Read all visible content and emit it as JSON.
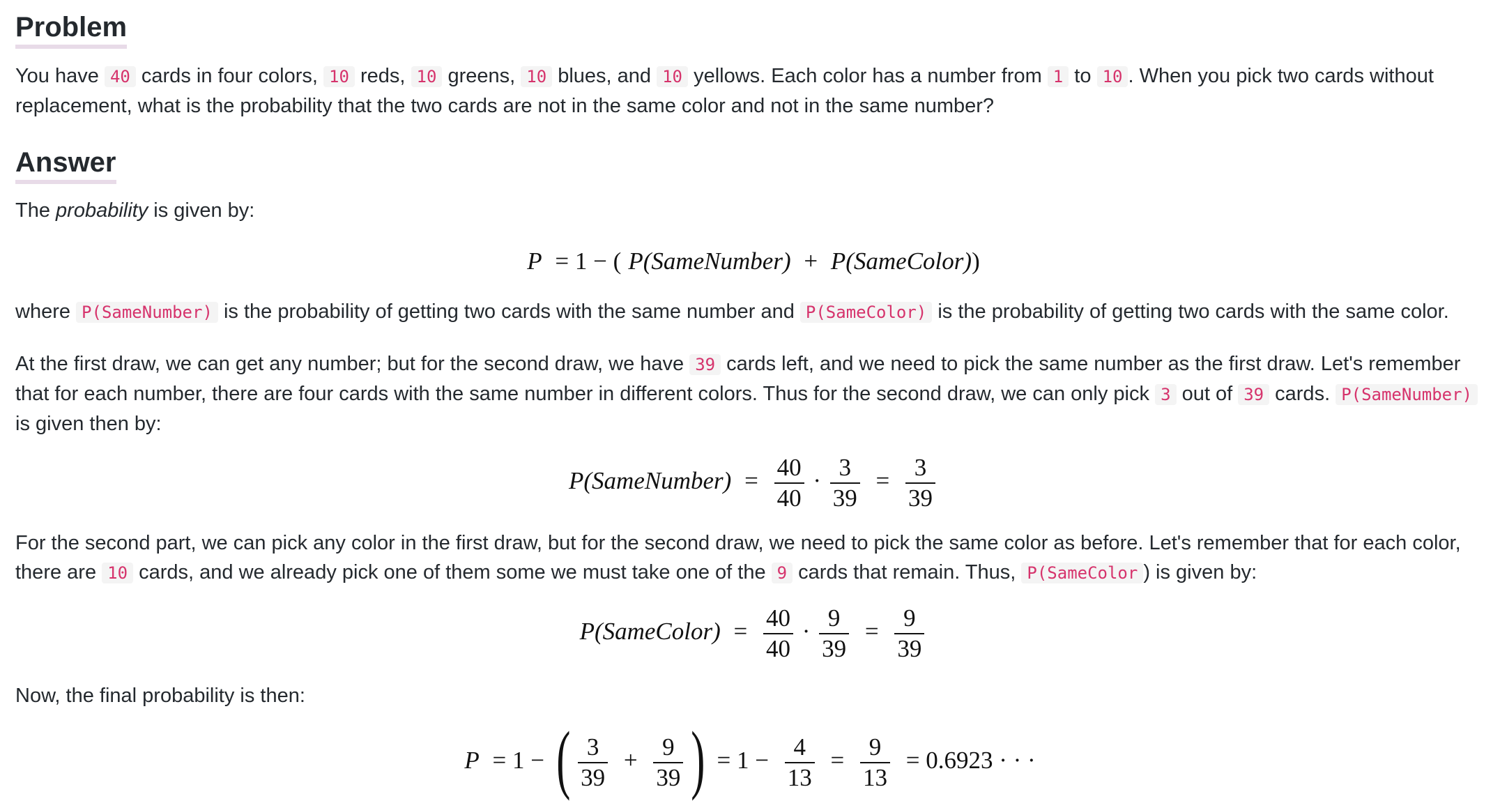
{
  "problem": {
    "heading": "Problem",
    "text1": "You have ",
    "code1": "40",
    "text2": " cards in four colors, ",
    "code2": "10",
    "text3": " reds, ",
    "code3": "10",
    "text4": " greens, ",
    "code4": "10",
    "text5": " blues, and ",
    "code5": "10",
    "text6": " yellows. Each color has a number from ",
    "code6": "1",
    "text7": " to ",
    "code7": "10",
    "text8": ". When you pick two cards without replacement, what is the probability that the two cards are not in the same color and not in the same number?"
  },
  "answer": {
    "heading": "Answer",
    "intro_pre": "The ",
    "intro_em": "probability",
    "intro_post": " is given by:",
    "eq1": {
      "lhs": "P",
      "rhs_a": "= 1 − (",
      "p1": "P",
      "arg1": "(SameNumber)",
      "plus": " + ",
      "p2": "P",
      "arg2": "(SameColor)",
      "close": ")"
    },
    "where": {
      "t1": "where ",
      "c1": "P(SameNumber)",
      "t2": " is the probability of getting two cards with the same number and ",
      "c2": "P(SameColor)",
      "t3": " is the probability of getting two cards with the same color."
    },
    "first_draw": {
      "t1": "At the first draw, we can get any number; but for the second draw, we have ",
      "c1": "39",
      "t2": " cards left, and we need to pick the same number as the first draw. Let's remember that for each number, there are four cards with the same number in different colors. Thus for the second draw, we can only pick ",
      "c2": "3",
      "t3": " out of ",
      "c3": "39",
      "t4": " cards. ",
      "c4": "P(SameNumber)",
      "t5": " is given then by:"
    },
    "eq2": {
      "lhs_p": "P",
      "lhs_arg": "(SameNumber)",
      "f1_num": "40",
      "f1_den": "40",
      "dot": "·",
      "f2_num": "3",
      "f2_den": "39",
      "eq": "=",
      "f3_num": "3",
      "f3_den": "39"
    },
    "second_part": {
      "t1": "For the second part, we can pick any color in the first draw, but for the second draw, we need to pick the same color as before. Let's remember that for each color, there are ",
      "c1": "10",
      "t2": " cards, and we already pick one of them some we must take one of the ",
      "c2": "9",
      "t3": " cards that remain. Thus, ",
      "c3": "P(SameColor",
      "t4": ") is given by:"
    },
    "eq3": {
      "lhs_p": "P",
      "lhs_arg": "(SameColor)",
      "f1_num": "40",
      "f1_den": "40",
      "dot": "·",
      "f2_num": "9",
      "f2_den": "39",
      "eq": "=",
      "f3_num": "9",
      "f3_den": "39"
    },
    "final_intro": "Now, the final probability is then:",
    "eq4": {
      "lhs": "P",
      "a": "= 1 −",
      "lp": "(",
      "f1_num": "3",
      "f1_den": "39",
      "plus": "+",
      "f2_num": "9",
      "f2_den": "39",
      "rp": ")",
      "b": "= 1 −",
      "f3_num": "4",
      "f3_den": "13",
      "c": "=",
      "f4_num": "9",
      "f4_den": "13",
      "d": "= 0.6923 · · ·"
    }
  }
}
